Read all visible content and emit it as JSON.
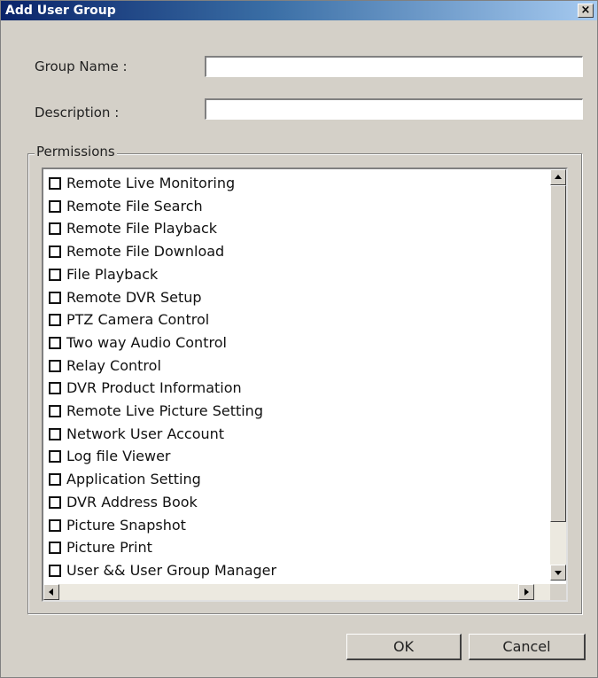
{
  "window": {
    "title": "Add User Group",
    "close_label": "×"
  },
  "form": {
    "group_name_label": "Group Name :",
    "group_name_value": "",
    "description_label": "Description :",
    "description_value": ""
  },
  "permissions": {
    "legend": "Permissions",
    "items": [
      {
        "label": "Remote Live Monitoring",
        "checked": false
      },
      {
        "label": "Remote File Search",
        "checked": false
      },
      {
        "label": "Remote File Playback",
        "checked": false
      },
      {
        "label": "Remote File Download",
        "checked": false
      },
      {
        "label": "File Playback",
        "checked": false
      },
      {
        "label": "Remote DVR Setup",
        "checked": false
      },
      {
        "label": "PTZ Camera Control",
        "checked": false
      },
      {
        "label": "Two way Audio Control",
        "checked": false
      },
      {
        "label": "Relay Control",
        "checked": false
      },
      {
        "label": "DVR Product Information",
        "checked": false
      },
      {
        "label": "Remote Live Picture Setting",
        "checked": false
      },
      {
        "label": "Network User Account",
        "checked": false
      },
      {
        "label": "Log file Viewer",
        "checked": false
      },
      {
        "label": "Application Setting",
        "checked": false
      },
      {
        "label": "DVR Address Book",
        "checked": false
      },
      {
        "label": "Picture Snapshot",
        "checked": false
      },
      {
        "label": "Picture Print",
        "checked": false
      },
      {
        "label": "User && User Group Manager",
        "checked": false
      }
    ]
  },
  "buttons": {
    "ok_label": "OK",
    "cancel_label": "Cancel"
  }
}
